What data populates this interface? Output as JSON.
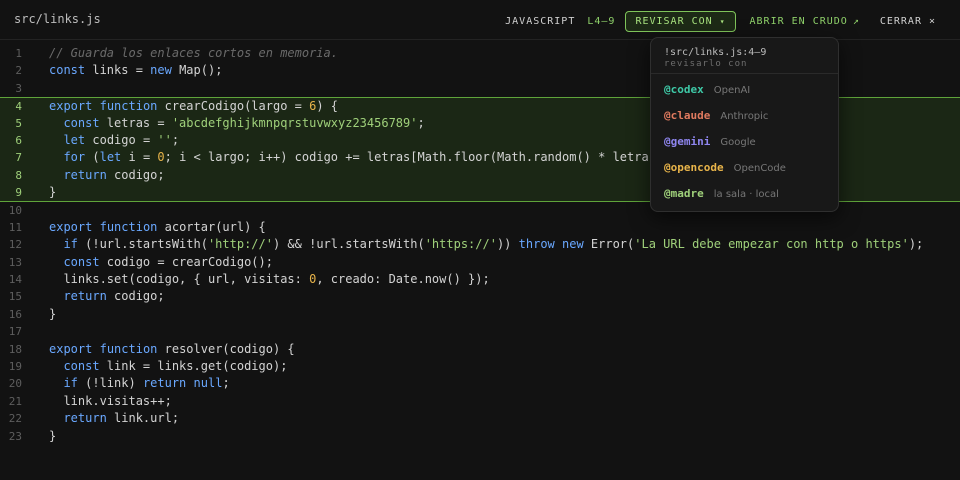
{
  "file": {
    "path": "src/links.js"
  },
  "toolbar": {
    "language": "JAVASCRIPT",
    "range": "L4–9",
    "review_label": "REVISAR CON",
    "review_caret": "▾",
    "raw_label": "ABRIR EN CRUDO",
    "raw_icon": "↗",
    "close_label": "CERRAR",
    "close_icon": "×"
  },
  "code": {
    "highlight": {
      "start": 4,
      "end": 9
    },
    "lines": [
      {
        "n": "1",
        "text": "// Guarda los enlaces cortos en memoria."
      },
      {
        "n": "2",
        "text": "const links = new Map();"
      },
      {
        "n": "3",
        "text": ""
      },
      {
        "n": "4",
        "text": "export function crearCodigo(largo = 6) {"
      },
      {
        "n": "5",
        "text": "  const letras = 'abcdefghijkmnpqrstuvwxyz23456789';"
      },
      {
        "n": "6",
        "text": "  let codigo = '';"
      },
      {
        "n": "7",
        "text": "  for (let i = 0; i < largo; i++) codigo += letras[Math.floor(Math.random() * letras.length)];"
      },
      {
        "n": "8",
        "text": "  return codigo;"
      },
      {
        "n": "9",
        "text": "}"
      },
      {
        "n": "10",
        "text": ""
      },
      {
        "n": "11",
        "text": "export function acortar(url) {"
      },
      {
        "n": "12",
        "text": "  if (!url.startsWith('http://') && !url.startsWith('https://')) throw new Error('La URL debe empezar con http o https');"
      },
      {
        "n": "13",
        "text": "  const codigo = crearCodigo();"
      },
      {
        "n": "14",
        "text": "  links.set(codigo, { url, visitas: 0, creado: Date.now() });"
      },
      {
        "n": "15",
        "text": "  return codigo;"
      },
      {
        "n": "16",
        "text": "}"
      },
      {
        "n": "17",
        "text": ""
      },
      {
        "n": "18",
        "text": "export function resolver(codigo) {"
      },
      {
        "n": "19",
        "text": "  const link = links.get(codigo);"
      },
      {
        "n": "20",
        "text": "  if (!link) return null;"
      },
      {
        "n": "21",
        "text": "  link.visitas++;"
      },
      {
        "n": "22",
        "text": "  return link.url;"
      },
      {
        "n": "23",
        "text": "}"
      }
    ]
  },
  "popup": {
    "path": "!src/links.js:4–9",
    "subtitle": "revisarlo con",
    "options": [
      {
        "handle": "@codex",
        "provider": "OpenAI",
        "color": "#3ec9a7"
      },
      {
        "handle": "@claude",
        "provider": "Anthropic",
        "color": "#e07a5f"
      },
      {
        "handle": "@gemini",
        "provider": "Google",
        "color": "#8f86f0"
      },
      {
        "handle": "@opencode",
        "provider": "OpenCode",
        "color": "#e8b44a"
      },
      {
        "handle": "@madre",
        "provider": "la sala · local",
        "color": "#9fd07a"
      }
    ]
  },
  "colors": {
    "background": "#121212",
    "accent": "#8fd16a",
    "keyword": "#6aa8ff",
    "string": "#9fd07a",
    "number": "#e8b44a",
    "comment": "#6a6a6a"
  }
}
